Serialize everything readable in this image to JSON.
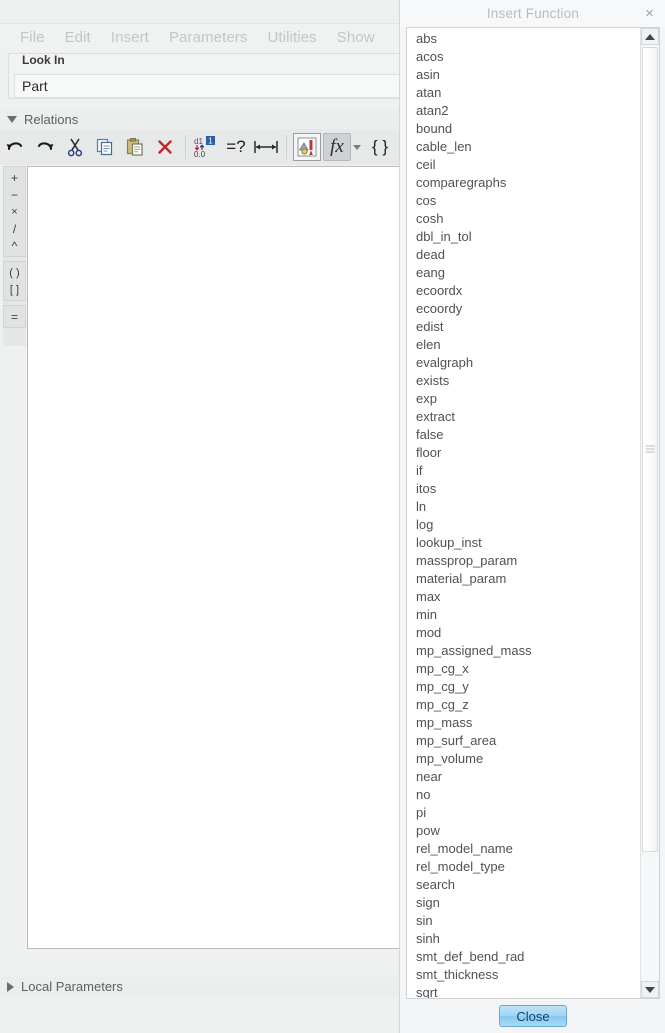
{
  "app": {
    "menubar": [
      "File",
      "Edit",
      "Insert",
      "Parameters",
      "Utilities",
      "Show"
    ],
    "look_in": {
      "legend": "Look In",
      "value": "Part"
    },
    "sections": {
      "relations_label": "Relations",
      "local_parameters_label": "Local Parameters"
    },
    "toolbar": {
      "undo": "undo-icon",
      "redo": "redo-icon",
      "cut": "cut-scissors-icon",
      "copy": "copy-icon",
      "paste": "paste-icon",
      "delete": "delete-x-icon",
      "switch_dimensions": "switch-dimensions-icon",
      "verify": "=?",
      "insert_dimension": "insert-dimension-icon",
      "insert_from_model": "insert-from-model-icon",
      "insert_function": "fx",
      "insert_function_caret": "chevron-down-icon",
      "braces": "{ }"
    },
    "operator_rail": {
      "arithmetic": [
        "+",
        "−",
        "×",
        "/",
        "^"
      ],
      "brackets": [
        "( )",
        "[ ]"
      ],
      "equals": [
        "="
      ]
    }
  },
  "dialog": {
    "title": "Insert Function",
    "close_icon": "×",
    "close_button_label": "Close",
    "scrollbar": {
      "up_icon": "triangle-up-icon",
      "down_icon": "triangle-down-icon"
    },
    "functions": [
      "abs",
      "acos",
      "asin",
      "atan",
      "atan2",
      "bound",
      "cable_len",
      "ceil",
      "comparegraphs",
      "cos",
      "cosh",
      "dbl_in_tol",
      "dead",
      "eang",
      "ecoordx",
      "ecoordy",
      "edist",
      "elen",
      "evalgraph",
      "exists",
      "exp",
      "extract",
      "false",
      "floor",
      "if",
      "itos",
      "ln",
      "log",
      "lookup_inst",
      "massprop_param",
      "material_param",
      "max",
      "min",
      "mod",
      "mp_assigned_mass",
      "mp_cg_x",
      "mp_cg_y",
      "mp_cg_z",
      "mp_mass",
      "mp_surf_area",
      "mp_volume",
      "near",
      "no",
      "pi",
      "pow",
      "rel_model_name",
      "rel_model_type",
      "search",
      "sign",
      "sin",
      "sinh",
      "smt_def_bend_rad",
      "smt_thickness",
      "sqrt"
    ]
  },
  "colors": {
    "window_bg": "#eff0f0",
    "dialog_bg": "#f4f5f6",
    "list_bg": "#ffffff",
    "accent_button": "#9fd4f3",
    "text": "#4e5254",
    "disabled_text": "#c3c6c8"
  }
}
